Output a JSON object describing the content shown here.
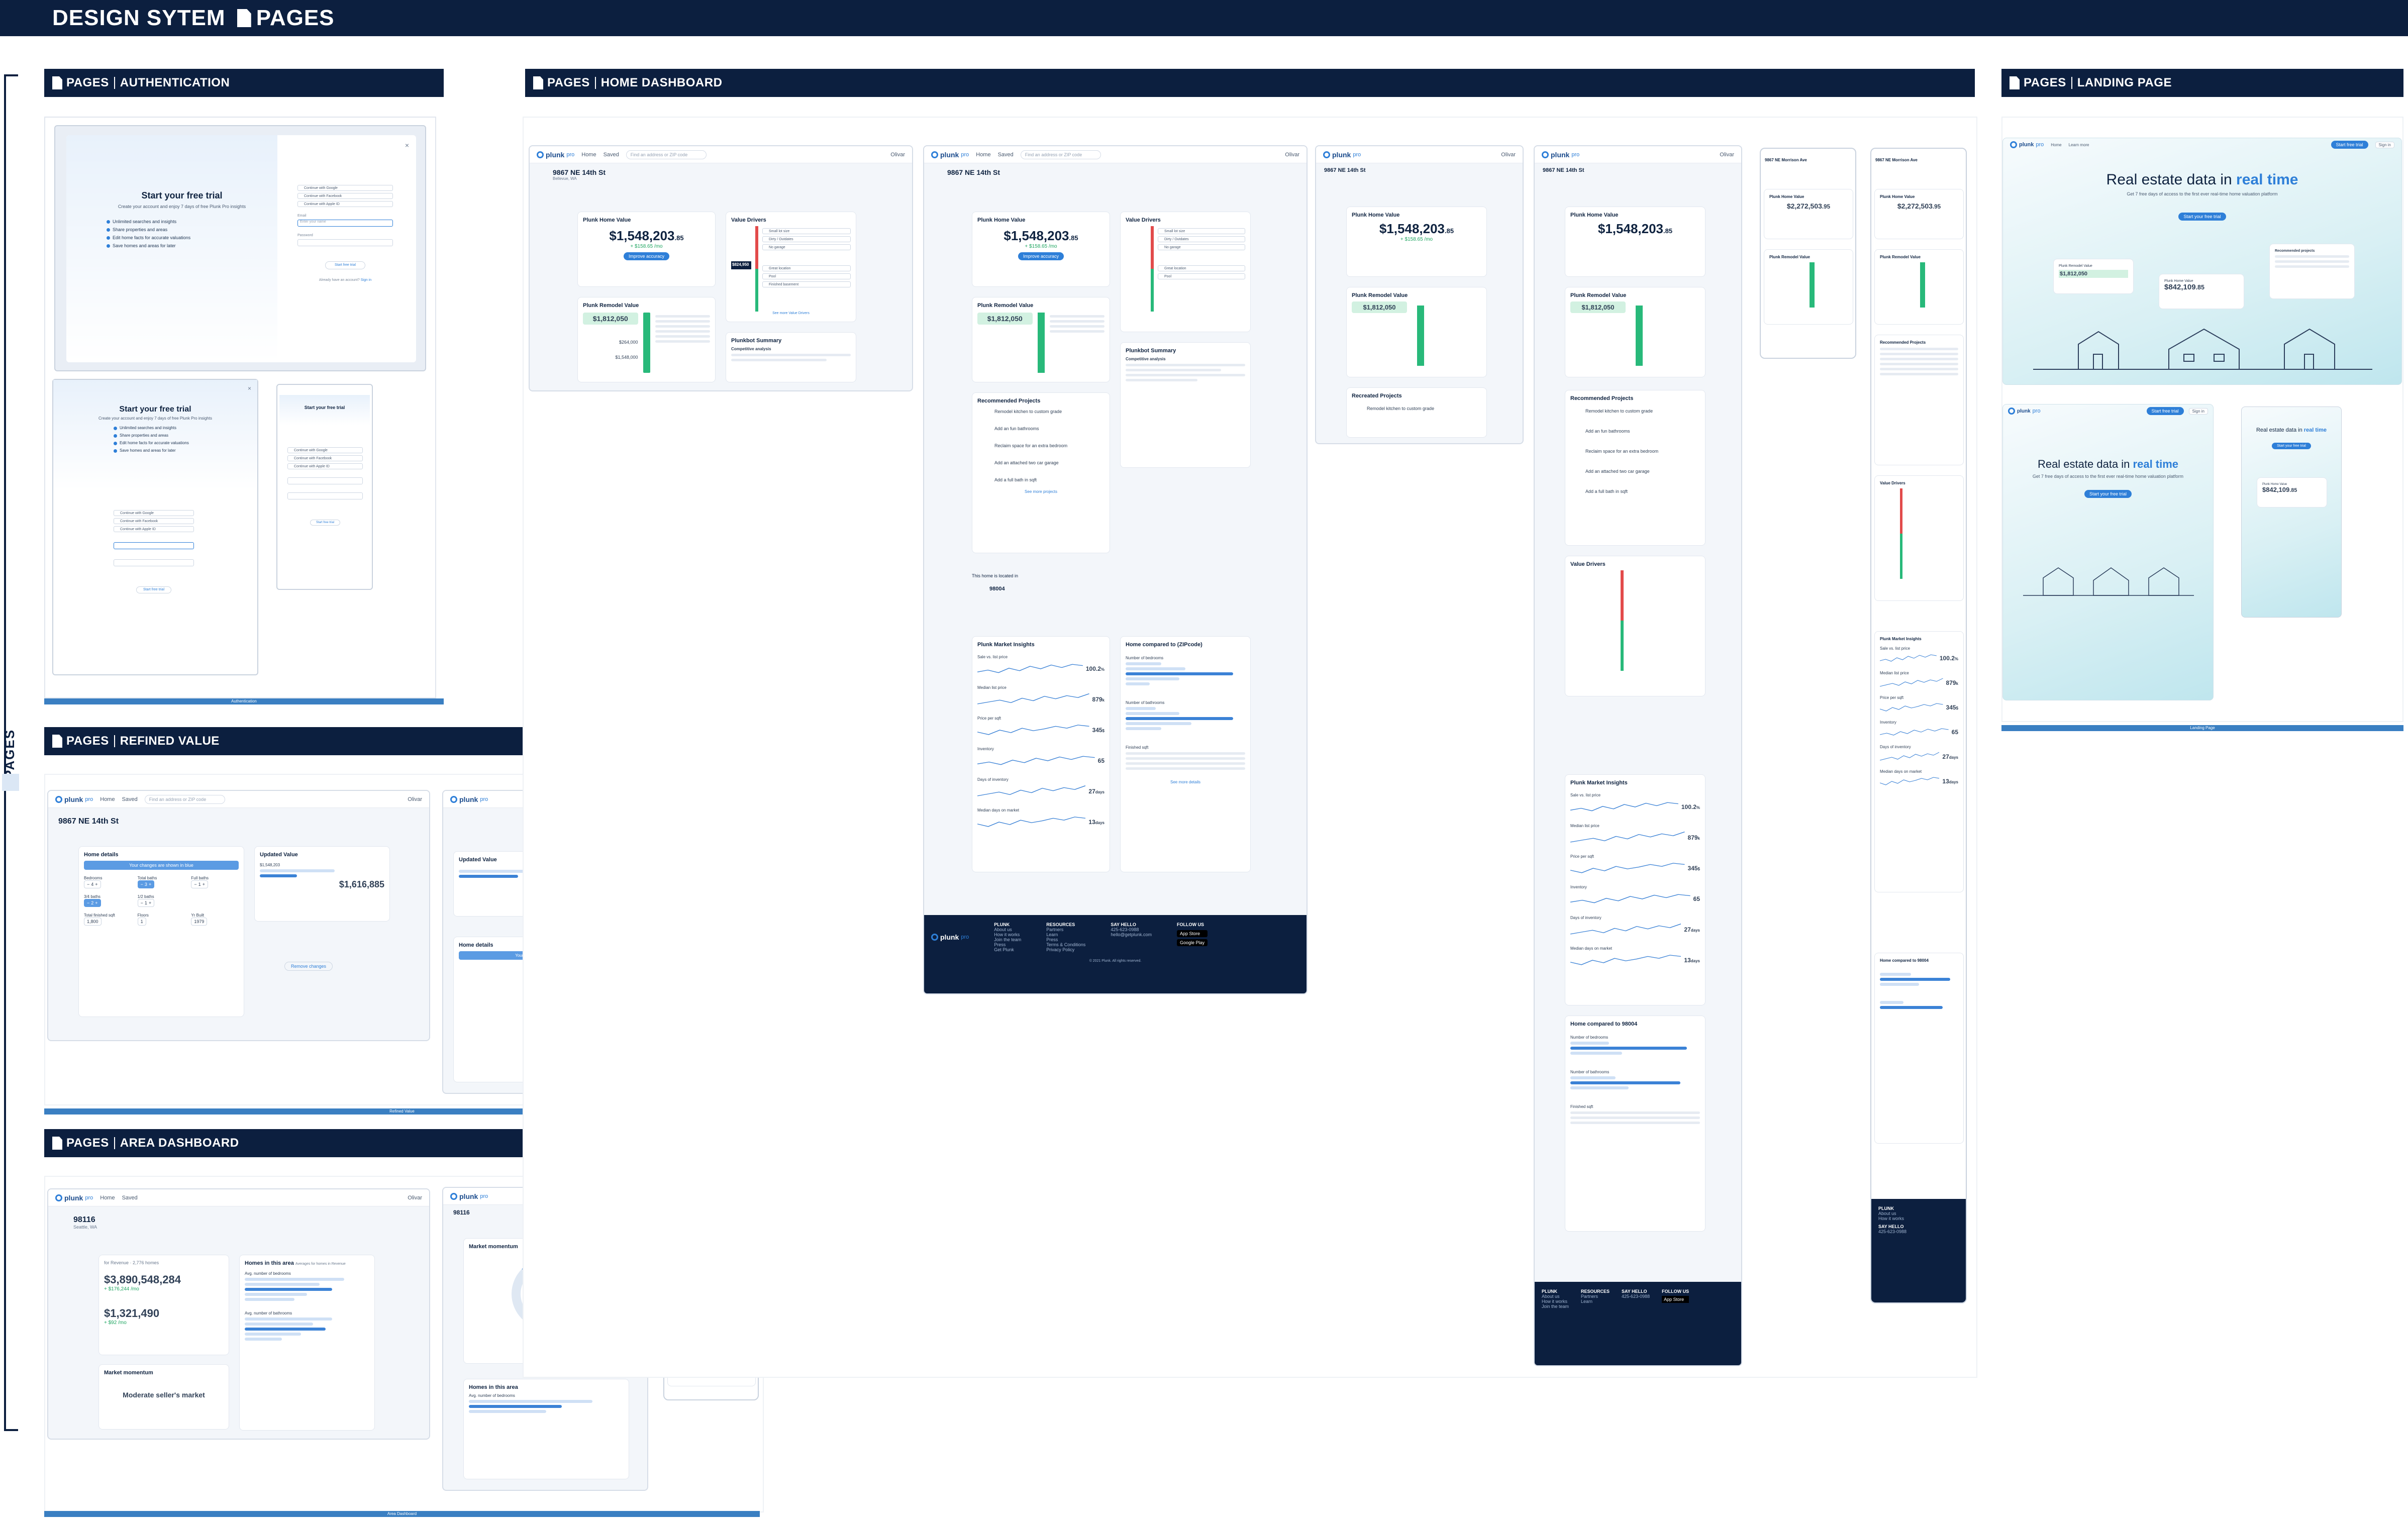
{
  "header": {
    "title_part1": "DESIGN SYTEM",
    "title_part2": "PAGES"
  },
  "sidebar": {
    "label": "PAGES"
  },
  "sections": {
    "authentication": {
      "prefix": "PAGES",
      "title": "AUTHENTICATION",
      "footer": "Authentication"
    },
    "refined_value": {
      "prefix": "PAGES",
      "title": "REFINED VALUE",
      "footer": "Refined Value"
    },
    "area_dashboard": {
      "prefix": "PAGES",
      "title": "AREA DASHBOARD",
      "footer": "Area Dashboard"
    },
    "home_dashboard": {
      "prefix": "PAGES",
      "title": "HOME DASHBOARD"
    },
    "landing_page": {
      "prefix": "PAGES",
      "title": "LANDING PAGE",
      "footer": "Landing Page"
    }
  },
  "brand": {
    "logo": "plunk",
    "logo_suffix": "pro",
    "accent": "#2e7fd8",
    "navy": "#0c1f3f"
  },
  "nav": {
    "home": "Home",
    "saved": "Saved",
    "search_placeholder": "Find an address or ZIP code",
    "user": "Olivar",
    "learn_more": "Learn more",
    "sign_in": "Sign in",
    "start_trial": "Start free trial"
  },
  "auth": {
    "title": "Start your free trial",
    "subtitle": "Create your account and enjoy 7 days of free Plunk Pro insights",
    "benefits": [
      "Unlimited searches and insights",
      "Share properties and areas",
      "Edit home facts for accurate valuations",
      "Save homes and areas for later"
    ],
    "social": [
      "Continue with Google",
      "Continue with Facebook",
      "Continue with Apple ID"
    ],
    "email_label": "Email",
    "email_placeholder": "Enter your name",
    "password_label": "Password",
    "cta": "Start free trial",
    "signin_prompt": "Already have an account?",
    "signin_link": "Sign in"
  },
  "property": {
    "address": "9867 NE 14th St",
    "city": "Bellevue, WA",
    "address2": "9867 NE Morrison Ave",
    "home_value_label": "Plunk Home Value",
    "home_value": "$1,548,203",
    "home_value_cents": ".85",
    "home_value_change": "+ $158.65 /mo",
    "improve_btn": "Improve accuracy",
    "remodel_label": "Plunk Remodel Value",
    "remodel_value": "$1,812,050",
    "remodel_low": "$264,000",
    "remodel_base": "$1,548,000",
    "value_drivers": "Value Drivers",
    "drivers": [
      "Small lot size",
      "Dirty / Outdates",
      "No garage",
      "Great location",
      "Pool",
      "Finished basement"
    ],
    "value_drivers_mid": "$824,950",
    "see_more_drivers": "See more Value Drivers",
    "plunkbot_label": "Plunkbot Summary",
    "plunkbot_sub": "Competitive analysis",
    "projects_label": "Recreated Projects",
    "projects_header": "Recommended Projects",
    "projects": [
      "Remodel kitchen to custom grade",
      "Add an fun bathrooms",
      "Reclaim space for an extra bedroom",
      "Add an attached two car garage",
      "Add a full bath in sqft"
    ],
    "see_more_projects": "See more projects",
    "located_in": "This home is located in",
    "zip": "98004",
    "zip_city": "Bellevue, WA",
    "market_label": "Plunk Market Insights",
    "market_sub": "for 98004",
    "market_metrics": [
      {
        "label": "Sale vs. list price",
        "value": "100.2",
        "unit": "%"
      },
      {
        "label": "Median list price",
        "value": "879",
        "unit": "k"
      },
      {
        "label": "Price per sqft",
        "value": "345",
        "unit": "$"
      },
      {
        "label": "Inventory",
        "value": "65",
        "unit": ""
      },
      {
        "label": "Days of inventory",
        "value": "27",
        "unit": "days"
      },
      {
        "label": "Median days on market",
        "value": "13",
        "unit": "days"
      }
    ],
    "compare_label": "Home compared to (ZIPcode)",
    "compare_label2": "Home compared to 98004",
    "bedrooms": "Number of bedrooms",
    "bathrooms": "Number of bathrooms",
    "finished": "Finished sqft",
    "see_more_details": "See more details",
    "alt_value": "$2,272,503",
    "alt_value_cents": ".95"
  },
  "refined": {
    "home_details": "Home details",
    "changes_banner": "Your changes are shown in blue",
    "updated_value": "Updated Value",
    "fields": [
      "Bedrooms",
      "Total baths",
      "Full baths",
      "3/4 baths",
      "1/2 baths",
      "Total finished sqft",
      "Floors",
      "Yr Built"
    ],
    "values": [
      "4",
      "3",
      "1",
      "2",
      "1",
      "1,800",
      "1",
      "1979"
    ],
    "updated_amount": "$1,616,885",
    "current_amount": "$1,548,203",
    "remove_changes": "Remove changes"
  },
  "area": {
    "zip": "98116",
    "city": "Seattle, WA",
    "rank_label": "for Revenue",
    "homes": "2,776 homes",
    "total_value": "$3,890,548,284",
    "total_change": "+ $176,244 /mo",
    "median_value": "$1,321,490",
    "median_change": "+ $92 /mo",
    "homes_in_area": "Homes in this area",
    "homes_sub": "Averages for homes in Revenue",
    "market_momentum": "Market momentum",
    "momentum_value": "Moderate seller's market",
    "avg_bedrooms": "Avg. number of bedrooms",
    "avg_bathrooms": "Avg. number of bathrooms"
  },
  "landing": {
    "hero_prefix": "Real estate data in",
    "hero_highlight": "real time",
    "hero_sub": "Get 7 free days of access to the first ever real-time home valuation platform",
    "cta": "Start your free trial",
    "card1_label": "Plunk Remodel Value",
    "card1_value": "$1,812,050",
    "card2_label": "Plunk Home Value",
    "card2_value": "$842,109",
    "card2_cents": ".85",
    "recommended": "Recommended projects"
  },
  "footer": {
    "plunk": [
      "About us",
      "How it works",
      "Join the team",
      "Press",
      "Get Plunk"
    ],
    "resources": [
      "Partners",
      "Learn",
      "Press",
      "Terms & Conditions",
      "Privacy Policy"
    ],
    "say_hello": "SAY HELLO",
    "follow": "FOLLOW US",
    "phone": "425-623-0988",
    "email": "hello@getplunk.com",
    "cols": [
      "PLUNK",
      "RESOURCES",
      "SAY HELLO",
      "FOLLOW US"
    ],
    "app_store": "App Store",
    "google_play": "Google Play",
    "copyright": "© 2021 Plunk. All rights reserved."
  }
}
